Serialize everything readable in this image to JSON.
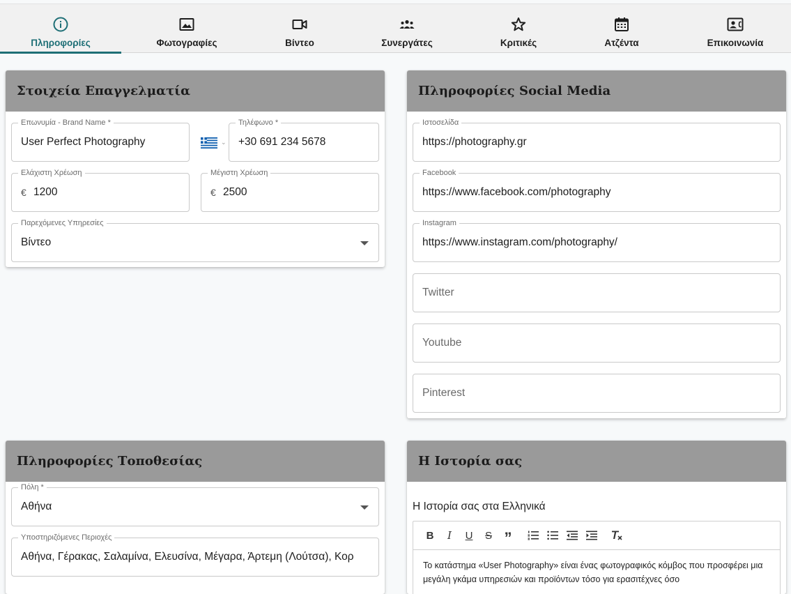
{
  "tabs": [
    {
      "label": "Πληροφορίες",
      "icon": "info-icon",
      "active": true
    },
    {
      "label": "Φωτογραφίες",
      "icon": "image-icon"
    },
    {
      "label": "Βίντεο",
      "icon": "videocam-icon"
    },
    {
      "label": "Συνεργάτες",
      "icon": "group-icon"
    },
    {
      "label": "Κριτικές",
      "icon": "star-icon"
    },
    {
      "label": "Ατζέντα",
      "icon": "calendar-icon"
    },
    {
      "label": "Επικοινωνία",
      "icon": "contact-card-icon"
    }
  ],
  "professional": {
    "title": "Στοιχεία Επαγγελματία",
    "brand_label": "Επωνυμία - Brand Name *",
    "brand_value": "User Perfect Photography",
    "phone_label": "Τηλέφωνο *",
    "phone_value": "+30 691 234 5678",
    "min_label": "Ελάχιστη Χρέωση",
    "min_currency": "€",
    "min_value": "1200",
    "max_label": "Μέγιστη Χρέωση",
    "max_currency": "€",
    "max_value": "2500",
    "services_label": "Παρεχόμενες Υπηρεσίες",
    "services_value": "Βίντεο"
  },
  "social": {
    "title": "Πληροφορίες Social Media",
    "website_label": "Ιστοσελίδα",
    "website_value": "https://photography.gr",
    "facebook_label": "Facebook",
    "facebook_value": "https://www.facebook.com/photography",
    "instagram_label": "Instagram",
    "instagram_value": "https://www.instagram.com/photography/",
    "twitter_placeholder": "Twitter",
    "youtube_placeholder": "Youtube",
    "pinterest_placeholder": "Pinterest"
  },
  "location": {
    "title": "Πληροφορίες Τοποθεσίας",
    "city_label": "Πόλη *",
    "city_value": "Αθήνα",
    "areas_label": "Υποστηριζόμενες Περιοχές",
    "areas_value": "Αθήνα, Γέρακας, Σαλαμίνα, Ελευσίνα, Μέγαρα, Άρτεμη (Λούτσα), Κορ"
  },
  "story": {
    "title": "Η Ιστορία σας",
    "editor_title": "Η Ιστορία σας στα Ελληνικά",
    "toolbar": {
      "bold": "B",
      "italic": "I",
      "underline": "U",
      "strike": "S",
      "quote": "”"
    },
    "body": "Το κατάστημα «User Photography» είναι ένας φωτογραφικός κόμβος που προσφέρει μια μεγάλη γκάμα υπηρεσιών και προϊόντων τόσο για ερασιτέχνες όσο"
  },
  "colors": {
    "accent": "#1e6f76",
    "card_header": "#9a9a9a"
  }
}
